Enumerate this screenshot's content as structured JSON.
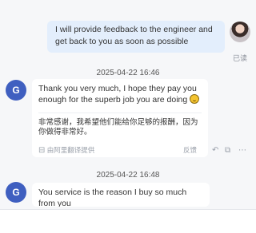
{
  "outgoing": {
    "text": "I will provide feedback to the engineer and get back to you as soon as possible",
    "read_status": "已读"
  },
  "messages": [
    {
      "timestamp": "2025-04-22 16:46",
      "avatar_letter": "G",
      "text": "Thank you very much, I hope they pay you enough for the superb job you are doing",
      "translation": "非常感谢，我希望他们能给你足够的报酬，因为你做得非常好。",
      "translation_credit": "由阿里翻译提供",
      "feedback_label": "反馈"
    },
    {
      "timestamp": "2025-04-22 16:48",
      "avatar_letter": "G",
      "text": "You service is the reason I buy so much from you"
    }
  ],
  "icons": {
    "reply": "reply-icon",
    "forward": "forward-icon",
    "more": "more-icon",
    "translate": "translate-icon",
    "emoji": "smiling-face-emoji"
  }
}
